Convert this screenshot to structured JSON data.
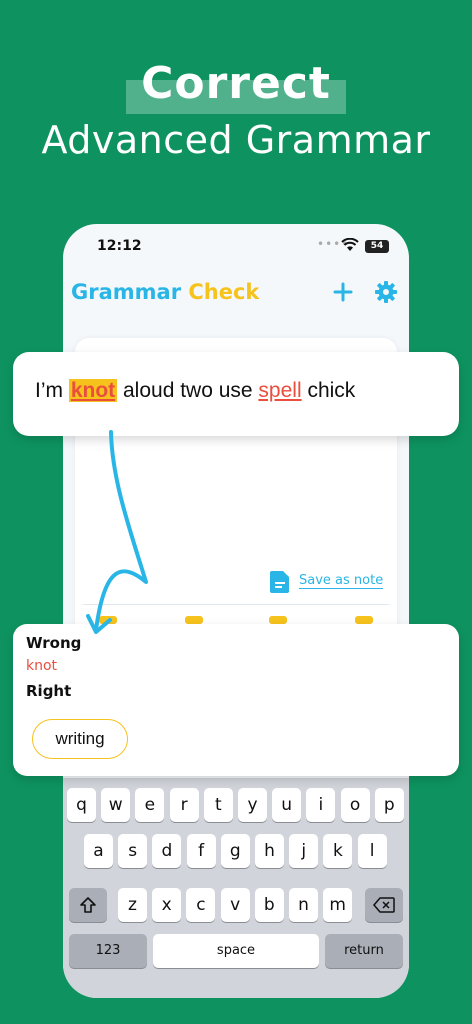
{
  "promo": {
    "headline": "Correct",
    "subheadline": "Advanced Grammar"
  },
  "status_bar": {
    "time": "12:12",
    "battery": "54"
  },
  "app": {
    "title_part1": "Grammar",
    "title_part2": "Check",
    "save_note_label": "Save as note"
  },
  "sentence": {
    "before": "I’m ",
    "wrong_word": "knot",
    "middle": " aloud two use ",
    "spell_word": "spell",
    "after": " chick"
  },
  "result": {
    "wrong_label": "Wrong",
    "wrong_value": "knot",
    "right_label": "Right",
    "suggestion": "writing"
  },
  "keyboard": {
    "row1": [
      "q",
      "w",
      "e",
      "r",
      "t",
      "y",
      "u",
      "i",
      "o",
      "p"
    ],
    "row2": [
      "a",
      "s",
      "d",
      "f",
      "g",
      "h",
      "j",
      "k",
      "l"
    ],
    "row3": [
      "z",
      "x",
      "c",
      "v",
      "b",
      "n",
      "m"
    ],
    "numbers_key": "123",
    "space_key": "space",
    "return_key": "return"
  },
  "colors": {
    "background": "#0e9360",
    "accent_blue": "#29b6e6",
    "accent_yellow": "#f6c21c",
    "error_red": "#ea4e3d"
  }
}
